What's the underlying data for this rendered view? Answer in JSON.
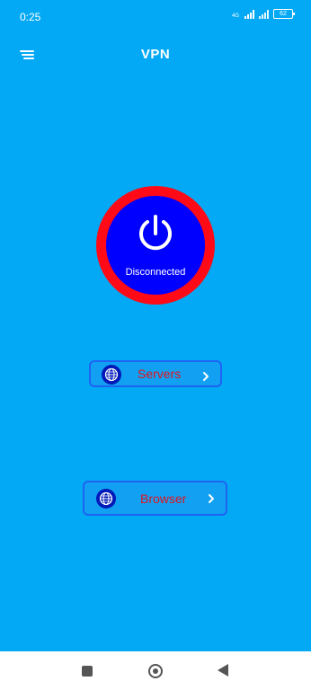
{
  "status_bar": {
    "time": "0:25",
    "network": "4G",
    "battery": "62"
  },
  "app_bar": {
    "title": "VPN"
  },
  "connection": {
    "status": "Disconnected"
  },
  "buttons": {
    "servers_label": "Servers",
    "browser_label": "Browser"
  },
  "colors": {
    "background": "#03A9F4",
    "power_ring": "#FF0A16",
    "power_button": "#0000FF",
    "button_border": "#1E63F2",
    "button_label": "#E0141E"
  },
  "icons": {
    "menu": "menu-icon",
    "power": "power-icon",
    "globe": "globe-icon",
    "chevron": "chevron-right-icon"
  }
}
